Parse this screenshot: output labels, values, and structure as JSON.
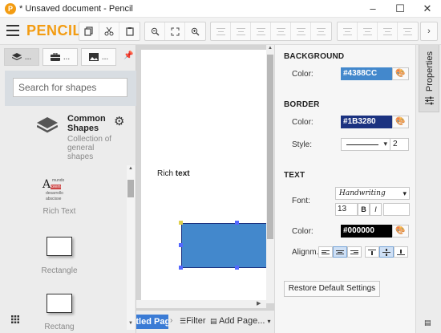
{
  "window": {
    "title": "* Unsaved document - Pencil",
    "logo_letter": "P",
    "minimize_glyph": "–",
    "maximize_glyph": "☐",
    "close_glyph": "✕"
  },
  "toolbar": {
    "brand": "PENCIL",
    "clipboard_icons": [
      "copy-icon",
      "cut-icon",
      "paste-icon"
    ],
    "zoom_icons": [
      "zoom-out-icon",
      "fit-icon",
      "zoom-in-icon"
    ]
  },
  "left_panel": {
    "tabs": [
      {
        "icon": "layers-icon",
        "label": "..."
      },
      {
        "icon": "toolbox-icon",
        "label": "..."
      },
      {
        "icon": "image-icon",
        "label": "..."
      }
    ],
    "search_placeholder": "Search for shapes",
    "collection": {
      "title": "Common Shapes",
      "description": "Collection of general shapes"
    },
    "shapes": [
      {
        "label": "Rich Text"
      },
      {
        "label": "Rectangle"
      },
      {
        "label": "Rectang"
      }
    ],
    "richtext_preview": [
      "mundo",
      "lorem",
      "desarrollo",
      "abscisse"
    ]
  },
  "canvas": {
    "rich_text_plain": "Rich ",
    "rich_text_bold": "text"
  },
  "bottom_bar": {
    "page_tab": "Untitled Page",
    "filter": "Filter",
    "add_page": "Add Page..."
  },
  "properties": {
    "background": {
      "title": "BACKGROUND",
      "color_label": "Color:",
      "color": "#4388CC"
    },
    "border": {
      "title": "BORDER",
      "color_label": "Color:",
      "color": "#1B3280",
      "style_label": "Style:",
      "width": "2"
    },
    "text": {
      "title": "TEXT",
      "font_label": "Font:",
      "font": "Handwriting",
      "size": "13",
      "bold": "B",
      "italic": "I",
      "color_label": "Color:",
      "color": "#000000",
      "align_label": "Alignm..."
    },
    "restore": "Restore Default Settings",
    "side_tab": "Properties"
  }
}
